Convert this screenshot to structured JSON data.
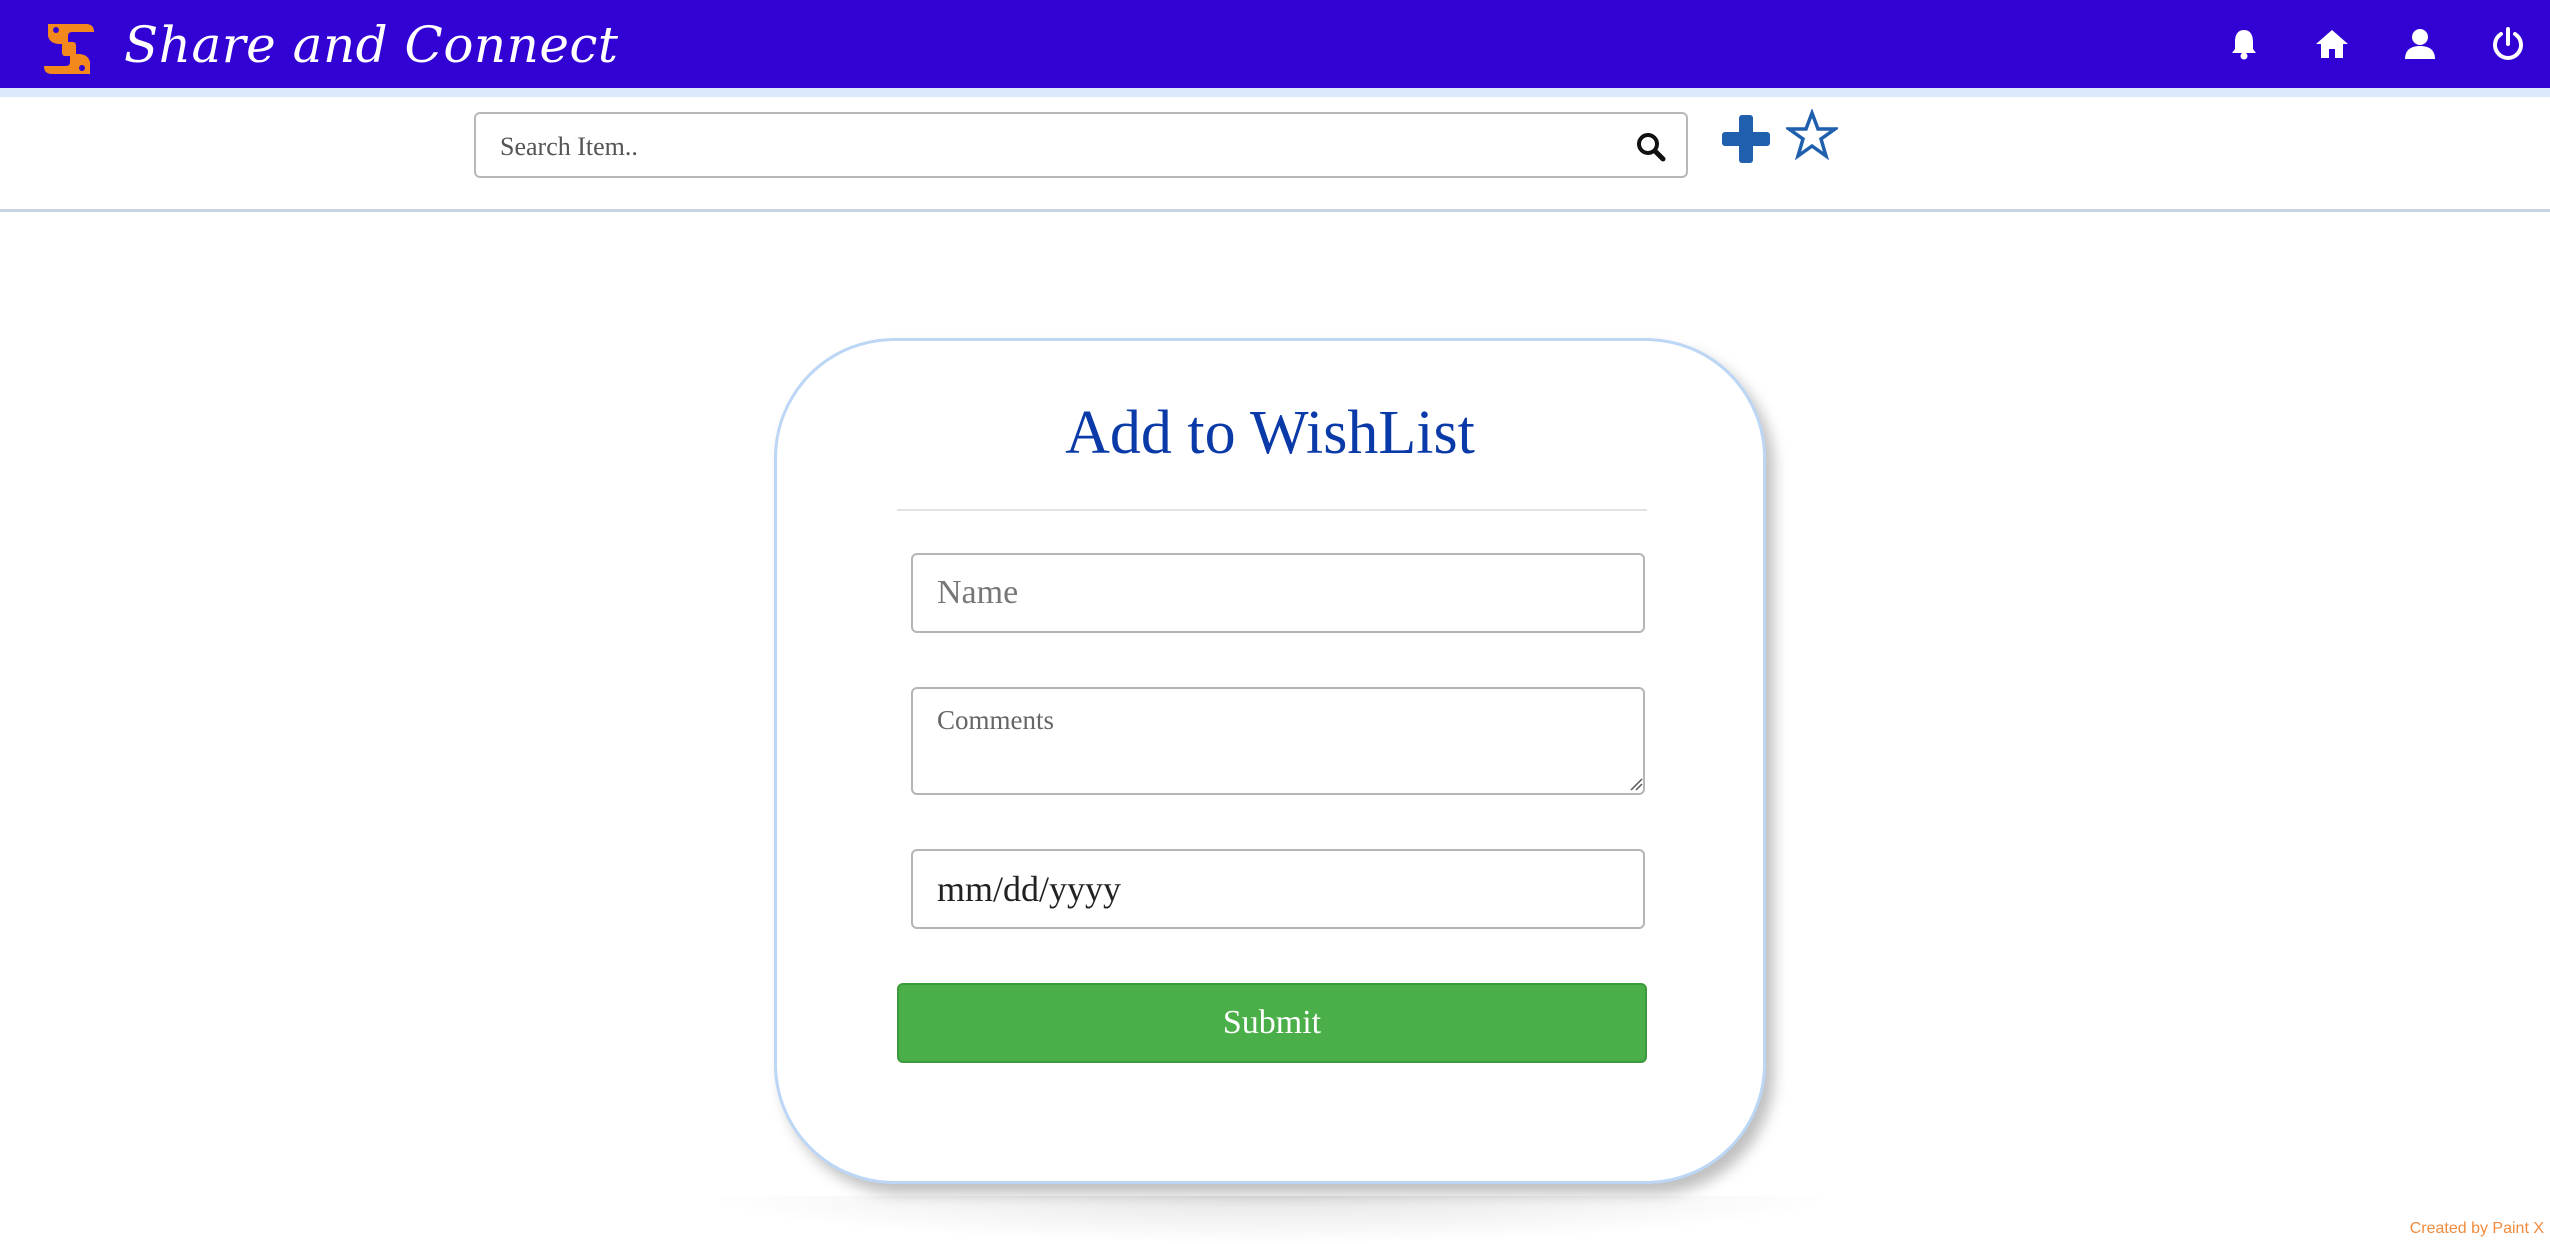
{
  "header": {
    "brand": "Share and Connect",
    "logo_icon": "hands-logo-icon",
    "nav_icons": [
      "bell-icon",
      "home-icon",
      "user-icon",
      "power-icon"
    ],
    "background_color": "#3202d4"
  },
  "toolbar": {
    "search_placeholder": "Search Item..",
    "search_icon": "search-icon",
    "add_icon": "plus-icon",
    "wishlist_icon": "star-outline-icon",
    "icon_color": "#1f5fae"
  },
  "form": {
    "title": "Add to WishList",
    "name_placeholder": "Name",
    "comments_placeholder": "Comments",
    "date_value": "mm/dd/yyyy",
    "submit_label": "Submit",
    "submit_color": "#4aaf48",
    "title_color": "#0a3aa8"
  },
  "footer": {
    "watermark": "Created by Paint X"
  }
}
